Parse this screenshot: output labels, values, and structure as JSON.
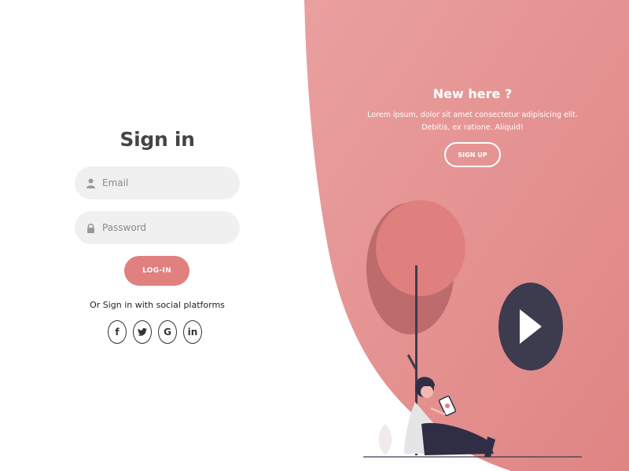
{
  "signin": {
    "title": "Sign in",
    "email_placeholder": "Email",
    "password_placeholder": "Password",
    "login_label": "LOG-IN",
    "social_text": "Or Sign in with social platforms",
    "social": [
      {
        "label": "f",
        "icon": "facebook-icon"
      },
      {
        "label": "twitter",
        "icon": "twitter-icon"
      },
      {
        "label": "G",
        "icon": "google-icon"
      },
      {
        "label": "in",
        "icon": "linkedin-icon"
      }
    ]
  },
  "panel": {
    "title": "New here ?",
    "text": "Lorem ipsum, dolor sit amet consectetur adipisicing elit. Debitis, ex ratione. Aliquid!",
    "signup_label": "SIGN UP"
  },
  "colors": {
    "accent": "#e0807f",
    "panel_light": "#e8a0a0",
    "panel_dark": "#e08584",
    "play": "#3d3b4e"
  }
}
